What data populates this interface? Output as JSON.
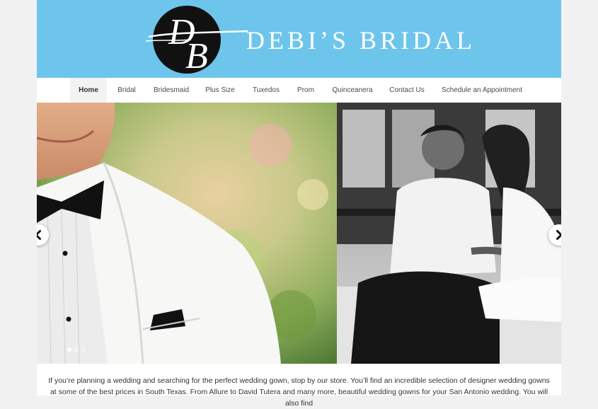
{
  "brand": {
    "monogram": "DB",
    "name": "DEBI’S BRIDAL"
  },
  "nav": {
    "items": [
      {
        "label": "Home",
        "active": true
      },
      {
        "label": "Bridal"
      },
      {
        "label": "Bridesmaid"
      },
      {
        "label": "Plus Size"
      },
      {
        "label": "Tuxedos"
      },
      {
        "label": "Prom"
      },
      {
        "label": "Quinceanera"
      },
      {
        "label": "Contact Us"
      },
      {
        "label": "Schedule an Appointment"
      }
    ]
  },
  "slider": {
    "prev_icon": "chevron-left-icon",
    "next_icon": "chevron-right-icon",
    "dots": 3,
    "active_dot": 1
  },
  "intro": {
    "text": "If you’re planning a wedding and searching for the perfect wedding gown, stop by our store. You’ll find an incredible selection of designer wedding gowns at some of the best prices in South Texas. From Allure to David Tutera and many more, beautiful wedding gowns for your San Antonio wedding. You will also find"
  },
  "colors": {
    "header_bg": "#6ec5ec",
    "page_bg": "#f1f1f1"
  }
}
